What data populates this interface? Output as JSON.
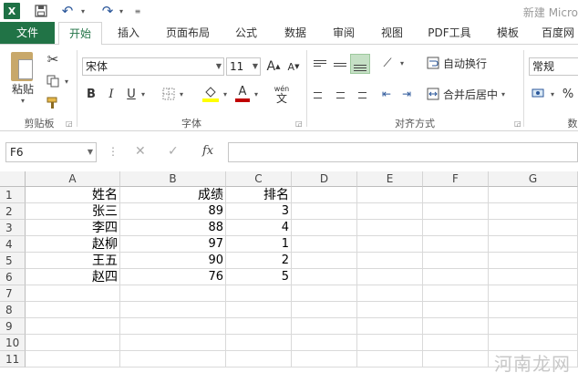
{
  "titlebar": {
    "logo": "X",
    "app_title": "新建 Micro"
  },
  "tabs": [
    "文件",
    "开始",
    "插入",
    "页面布局",
    "公式",
    "数据",
    "审阅",
    "视图",
    "PDF工具",
    "模板",
    "百度网"
  ],
  "ribbon": {
    "clipboard": {
      "paste_label": "粘贴",
      "group_label": "剪贴板"
    },
    "font": {
      "font_name": "宋体",
      "font_size": "11",
      "bold": "B",
      "italic": "I",
      "underline": "U",
      "wen": "wén",
      "wen_char": "文",
      "grow": "A",
      "shrink": "A",
      "fill_color": "#ffff00",
      "font_color": "#c00000",
      "group_label": "字体"
    },
    "alignment": {
      "wrap_text": "自动换行",
      "merge_center": "合并后居中",
      "group_label": "对齐方式"
    },
    "number": {
      "format": "常规",
      "percent": "%",
      "group_label_partial": "数"
    }
  },
  "formula_bar": {
    "name_box": "F6",
    "fx": "fx",
    "cancel": "✕",
    "enter": "✓"
  },
  "grid": {
    "columns": [
      "A",
      "B",
      "C",
      "D",
      "E",
      "F",
      "G"
    ],
    "rows": [
      "1",
      "2",
      "3",
      "4",
      "5",
      "6",
      "7",
      "8",
      "9",
      "10",
      "11"
    ],
    "cells": [
      [
        "姓名",
        "成绩",
        "排名"
      ],
      [
        "张三",
        "89",
        "3"
      ],
      [
        "李四",
        "88",
        "4"
      ],
      [
        "赵柳",
        "97",
        "1"
      ],
      [
        "王五",
        "90",
        "2"
      ],
      [
        "赵四",
        "76",
        "5"
      ]
    ]
  },
  "watermark": "河南龙网"
}
